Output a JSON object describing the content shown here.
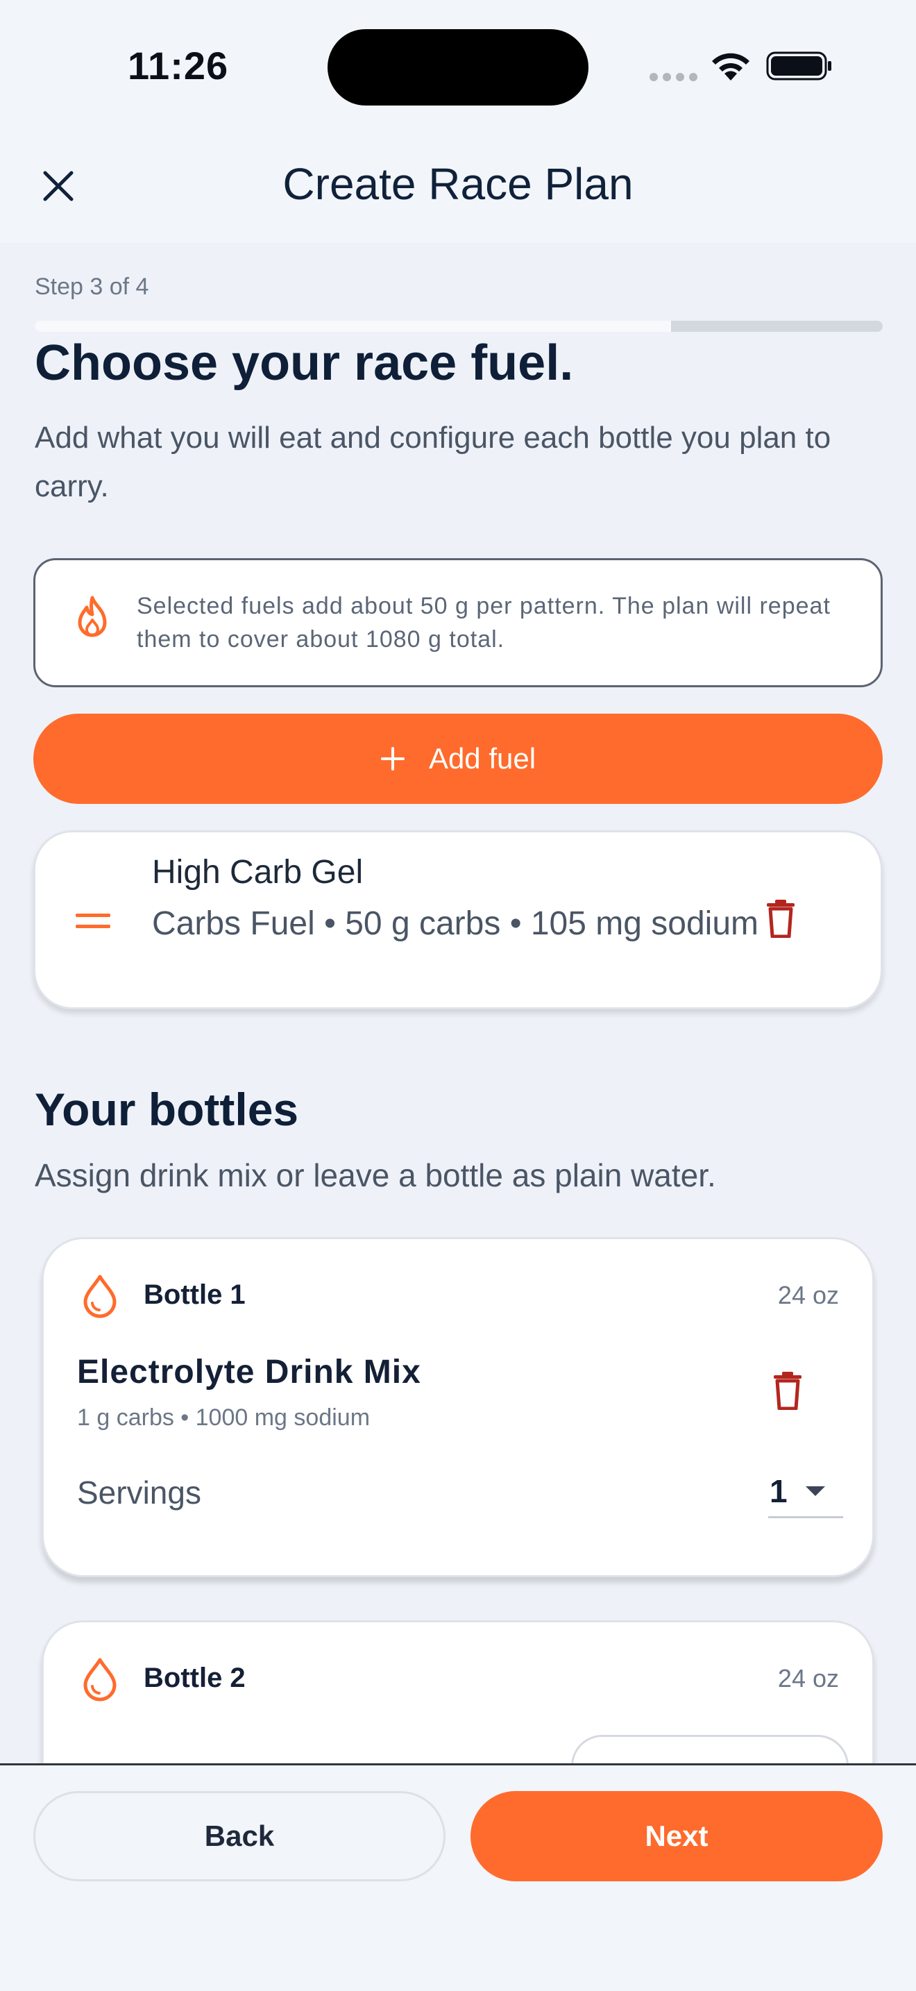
{
  "status_bar": {
    "time": "11:26"
  },
  "header": {
    "title": "Create Race Plan"
  },
  "progress": {
    "step_label": "Step 3 of 4",
    "fraction": 0.75
  },
  "intro": {
    "heading": "Choose your race fuel.",
    "subtext": "Add what you will eat and configure each bottle you plan to carry."
  },
  "info": {
    "text": "Selected fuels add about 50 g per pattern. The plan will repeat them to cover about 1080 g total.",
    "icon": "flame-icon"
  },
  "add_fuel": {
    "label": "Add fuel"
  },
  "fuels": [
    {
      "name": "High Carb Gel",
      "detail": "Carbs Fuel • 50 g carbs • 105 mg sodium"
    }
  ],
  "bottles_section": {
    "title": "Your bottles",
    "subtitle": "Assign drink mix or leave a bottle as plain water."
  },
  "bottles": [
    {
      "title": "Bottle 1",
      "size": "24 oz",
      "mix_name": "Electrolyte Drink Mix",
      "mix_detail": "1 g carbs • 1000 mg sodium",
      "servings_label": "Servings",
      "servings_value": "1"
    },
    {
      "title": "Bottle 2",
      "size": "24 oz"
    }
  ],
  "footer": {
    "back_label": "Back",
    "next_label": "Next"
  },
  "colors": {
    "accent": "#ff6b2c",
    "danger": "#b3261e",
    "text": "#10213a"
  }
}
